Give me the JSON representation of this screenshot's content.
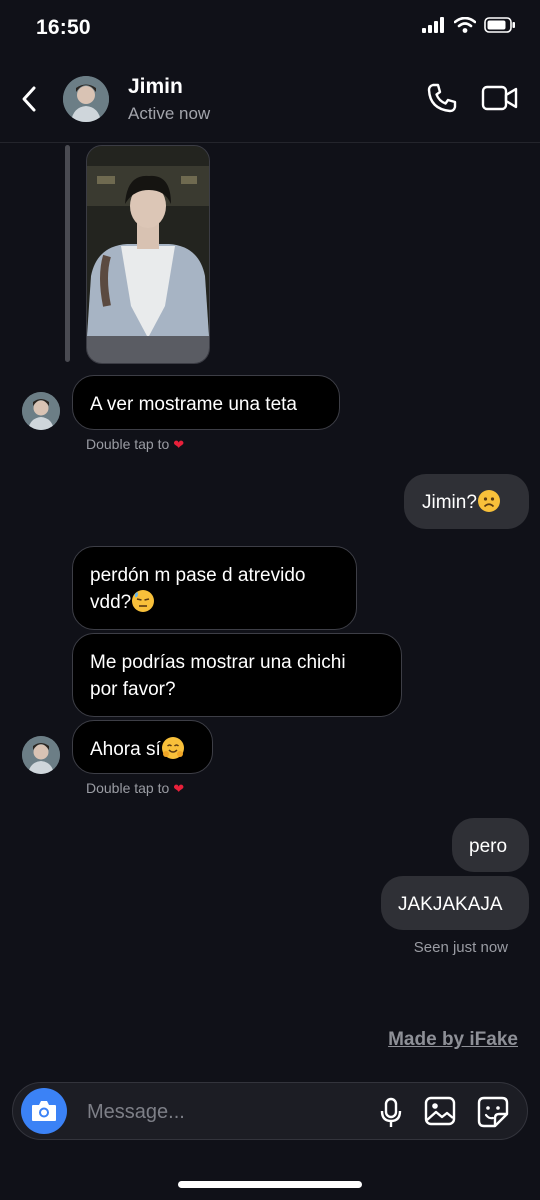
{
  "status_bar": {
    "time": "16:50"
  },
  "header": {
    "name": "Jimin",
    "status": "Active now"
  },
  "messages": [
    {
      "side": "in",
      "text": "A ver mostrame una teta",
      "emoji": "",
      "hint": "Double tap to"
    },
    {
      "side": "out",
      "text": "Jimin?",
      "emoji": "frowning-face"
    },
    {
      "side": "in",
      "text_line1": "perdón m pase d atrevido",
      "text_line2": "vdd?",
      "emoji": "sweat-face"
    },
    {
      "side": "in",
      "text_line1": "Me podrías mostrar una chichi",
      "text_line2": "por favor?"
    },
    {
      "side": "in",
      "text": "Ahora sí",
      "emoji": "hugging-face",
      "hint": "Double tap to"
    },
    {
      "side": "out",
      "text": "pero"
    },
    {
      "side": "out",
      "text": "JAKJAKAJA"
    }
  ],
  "seen": "Seen just now",
  "watermark": "Made by iFake",
  "composer": {
    "placeholder": "Message..."
  },
  "colors": {
    "background": "#101118",
    "accent": "#3b82f6",
    "heart": "#e8203a"
  },
  "icons": [
    "back-arrow-icon",
    "phone-icon",
    "video-icon",
    "camera-icon",
    "microphone-icon",
    "image-icon",
    "sticker-icon",
    "heart-icon"
  ]
}
